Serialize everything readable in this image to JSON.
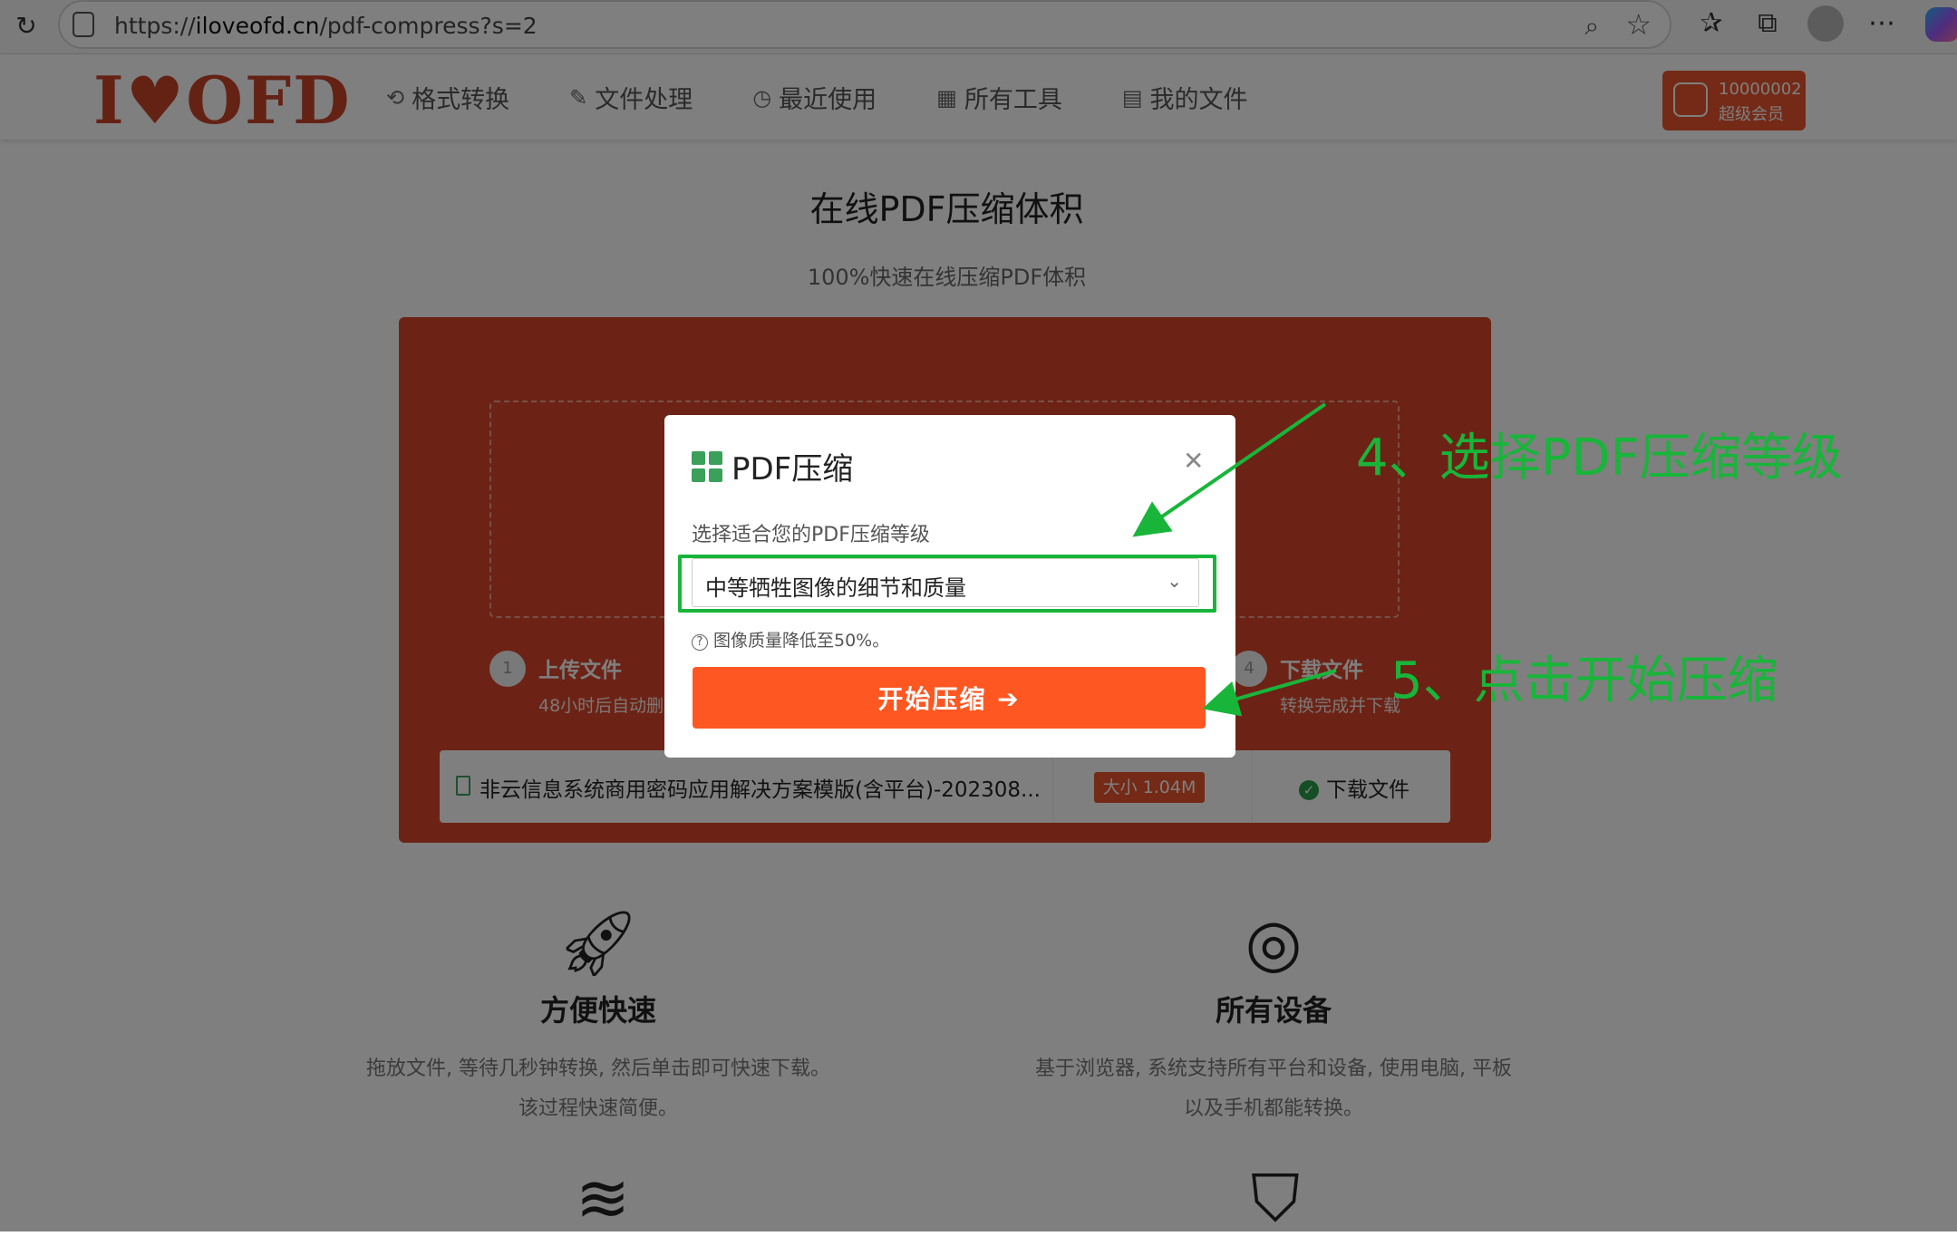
{
  "browser": {
    "url_prefix": "https://",
    "url_domain": "iloveofd.cn",
    "url_path": "/pdf-compress?s=2"
  },
  "site": {
    "logo_text": "I♥OFD",
    "nav": [
      {
        "label": "格式转换",
        "icon": "convert-icon"
      },
      {
        "label": "文件处理",
        "icon": "file-edit-icon"
      },
      {
        "label": "最近使用",
        "icon": "recent-icon"
      },
      {
        "label": "所有工具",
        "icon": "grid-icon"
      },
      {
        "label": "我的文件",
        "icon": "my-files-icon"
      }
    ],
    "user": {
      "id": "10000002",
      "level": "超级会员"
    }
  },
  "page": {
    "title": "在线PDF压缩体积",
    "subtitle": "100%快速在线压缩PDF体积",
    "steps": [
      {
        "num": "1",
        "title": "上传文件",
        "desc": "48小时后自动删"
      },
      {
        "num": "4",
        "title": "下载文件",
        "desc": "转换完成并下载"
      }
    ],
    "file": {
      "name": "非云信息系统商用密码应用解决方案模版(含平台)-202308...",
      "size": "大小 1.04M",
      "download": "下载文件"
    },
    "features": [
      {
        "title": "方便快速",
        "desc1": "拖放文件, 等待几秒钟转换, 然后单击即可快速下载。",
        "desc2": "该过程快速简便。"
      },
      {
        "title": "所有设备",
        "desc1": "基于浏览器, 系统支持所有平台和设备, 使用电脑, 平板",
        "desc2": "以及手机都能转换。"
      }
    ]
  },
  "dialog": {
    "title": "PDF压缩",
    "label": "选择适合您的PDF压缩等级",
    "selected": "中等牺牲图像的细节和质量",
    "hint": "图像质量降低至50%。",
    "start_button": "开始压缩 ➔"
  },
  "annotations": {
    "step4": "4、选择PDF压缩等级",
    "step5": "5、点击开始压缩",
    "color": "#18b53a"
  }
}
